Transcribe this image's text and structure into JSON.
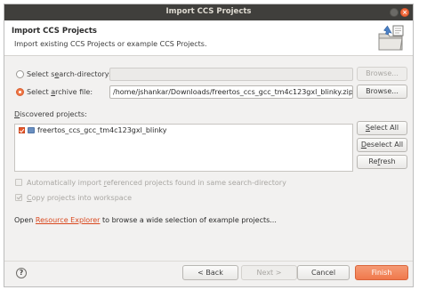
{
  "window": {
    "title": "Import CCS Projects"
  },
  "header": {
    "title": "Import CCS Projects",
    "description": "Import existing CCS Projects or example CCS Projects.",
    "icon": "import-wizard-icon"
  },
  "search_directory": {
    "label_pre": "Select s",
    "label_key": "e",
    "label_post": "arch-directory:",
    "selected": false,
    "value": "",
    "browse_label": "Browse..."
  },
  "archive_file": {
    "label_pre": "Select ",
    "label_key": "a",
    "label_post": "rchive file:",
    "selected": true,
    "value": "/home/jshankar/Downloads/freertos_ccs_gcc_tm4c123gxl_blinky.zip",
    "browse_label": "Browse..."
  },
  "discovered": {
    "label_key": "D",
    "label_post": "iscovered projects:",
    "projects": [
      {
        "name": "freertos_ccs_gcc_tm4c123gxl_blinky",
        "checked": true
      }
    ],
    "select_all_key": "S",
    "select_all_post": "elect All",
    "deselect_all_key": "D",
    "deselect_all_post": "eselect All",
    "refresh_pre": "Re",
    "refresh_key": "f",
    "refresh_post": "resh"
  },
  "options": {
    "auto_import": {
      "pre": "Automatically import ",
      "key": "r",
      "post": "eferenced projects found in same search-directory",
      "checked": false
    },
    "copy_projects": {
      "key": "C",
      "post": "opy projects into workspace",
      "checked": true
    }
  },
  "resource_explorer": {
    "before": "Open ",
    "link": "Resource Explorer",
    "after": " to browse a wide selection of example projects..."
  },
  "footer": {
    "help": "?",
    "back_label": "< Back",
    "next_label": "Next >",
    "cancel_label": "Cancel",
    "finish_label": "Finish"
  },
  "colors": {
    "titlebar": "#403f3c",
    "accent": "#f0794c",
    "link": "#d9481e"
  }
}
